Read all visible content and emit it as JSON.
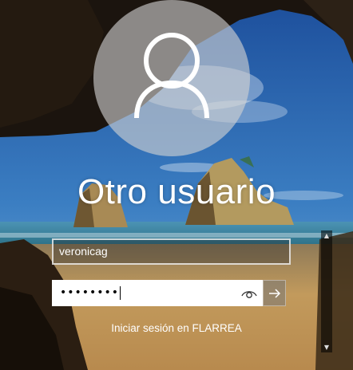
{
  "login": {
    "user_display_name": "Otro usuario",
    "username_value": "veronicag",
    "password_masked": "••••••••",
    "signin_domain_text": "Iniciar sesión en FLARREA"
  },
  "icons": {
    "avatar": "user-avatar-icon",
    "reveal": "eye-icon",
    "submit": "arrow-right-icon",
    "scroll_up": "chevron-up-icon",
    "scroll_down": "chevron-down-icon"
  },
  "colors": {
    "sky_top": "#1f4f9a",
    "sea": "#2f7c98",
    "sand": "#c29a5c",
    "rock_dark": "#1b140e",
    "text": "#ffffff"
  }
}
